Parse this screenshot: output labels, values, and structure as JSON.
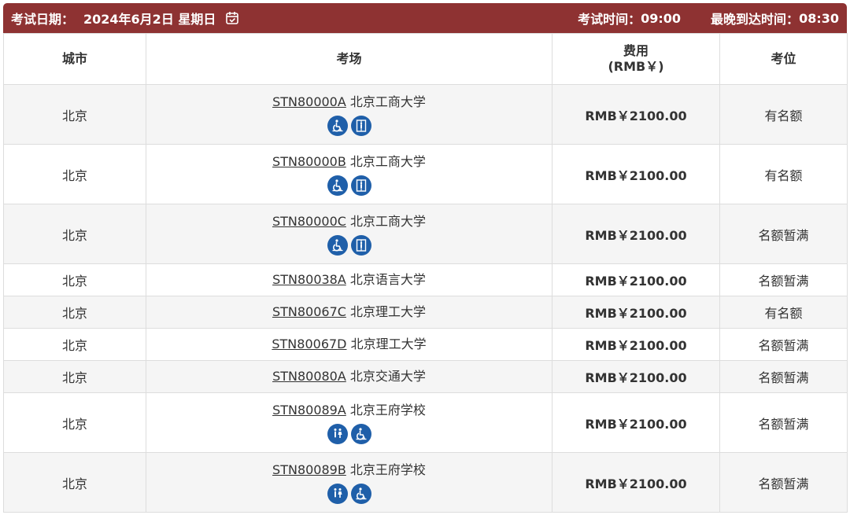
{
  "header": {
    "date_label": "考试日期：",
    "date_value": "2024年6月2日 星期日",
    "exam_time_label": "考试时间：",
    "exam_time_value": "09:00",
    "arrival_label": "最晚到达时间：",
    "arrival_value": "08:30"
  },
  "table": {
    "columns": [
      "城市",
      "考场",
      "费用",
      "(RMB￥)",
      "考位"
    ],
    "rows": [
      {
        "city": "北京",
        "code": "STN80000A",
        "name": "北京工商大学",
        "fee": "RMB￥2100.00",
        "seats": "有名额",
        "icons": [
          "wheelchair-icon",
          "elevator-icon"
        ]
      },
      {
        "city": "北京",
        "code": "STN80000B",
        "name": "北京工商大学",
        "fee": "RMB￥2100.00",
        "seats": "有名额",
        "icons": [
          "wheelchair-icon",
          "elevator-icon"
        ]
      },
      {
        "city": "北京",
        "code": "STN80000C",
        "name": "北京工商大学",
        "fee": "RMB￥2100.00",
        "seats": "名额暂满",
        "icons": [
          "wheelchair-icon",
          "elevator-icon"
        ]
      },
      {
        "city": "北京",
        "code": "STN80038A",
        "name": "北京语言大学",
        "fee": "RMB￥2100.00",
        "seats": "名额暂满",
        "icons": []
      },
      {
        "city": "北京",
        "code": "STN80067C",
        "name": "北京理工大学",
        "fee": "RMB￥2100.00",
        "seats": "有名额",
        "icons": []
      },
      {
        "city": "北京",
        "code": "STN80067D",
        "name": "北京理工大学",
        "fee": "RMB￥2100.00",
        "seats": "名额暂满",
        "icons": []
      },
      {
        "city": "北京",
        "code": "STN80080A",
        "name": "北京交通大学",
        "fee": "RMB￥2100.00",
        "seats": "名额暂满",
        "icons": []
      },
      {
        "city": "北京",
        "code": "STN80089A",
        "name": "北京王府学校",
        "fee": "RMB￥2100.00",
        "seats": "名额暂满",
        "icons": [
          "restroom-icon",
          "wheelchair-icon"
        ]
      },
      {
        "city": "北京",
        "code": "STN80089B",
        "name": "北京王府学校",
        "fee": "RMB￥2100.00",
        "seats": "名额暂满",
        "icons": [
          "restroom-icon",
          "wheelchair-icon"
        ]
      }
    ]
  },
  "colors": {
    "header_bg": "#8e3232",
    "icon_bg": "#1f5fa9",
    "row_alt": "#f5f5f5"
  }
}
